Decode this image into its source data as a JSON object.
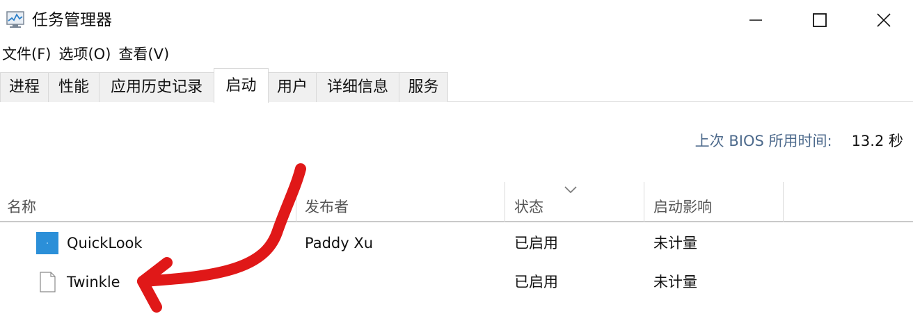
{
  "window": {
    "title": "任务管理器",
    "icon": "task-manager-icon"
  },
  "menu": [
    "文件(F)",
    "选项(O)",
    "查看(V)"
  ],
  "tabs": [
    {
      "label": "进程"
    },
    {
      "label": "性能"
    },
    {
      "label": "应用历史记录"
    },
    {
      "label": "启动",
      "active": true
    },
    {
      "label": "用户"
    },
    {
      "label": "详细信息"
    },
    {
      "label": "服务"
    }
  ],
  "bios": {
    "label": "上次 BIOS 所用时间:",
    "value": "13.2 秒"
  },
  "table": {
    "columns": [
      "名称",
      "发布者",
      "状态",
      "启动影响"
    ],
    "sorted_column": "状态",
    "rows": [
      {
        "name": "QuickLook",
        "publisher": "Paddy Xu",
        "status": "已启用",
        "impact": "未计量",
        "icon": "quicklook-app-icon"
      },
      {
        "name": "Twinkle",
        "publisher": "",
        "status": "已启用",
        "impact": "未计量",
        "icon": "blank-file-icon"
      }
    ]
  },
  "colors": {
    "accent_blue": "#2b8fd8",
    "annotation_red": "#e01818",
    "bios_label": "#4d6a8c"
  }
}
